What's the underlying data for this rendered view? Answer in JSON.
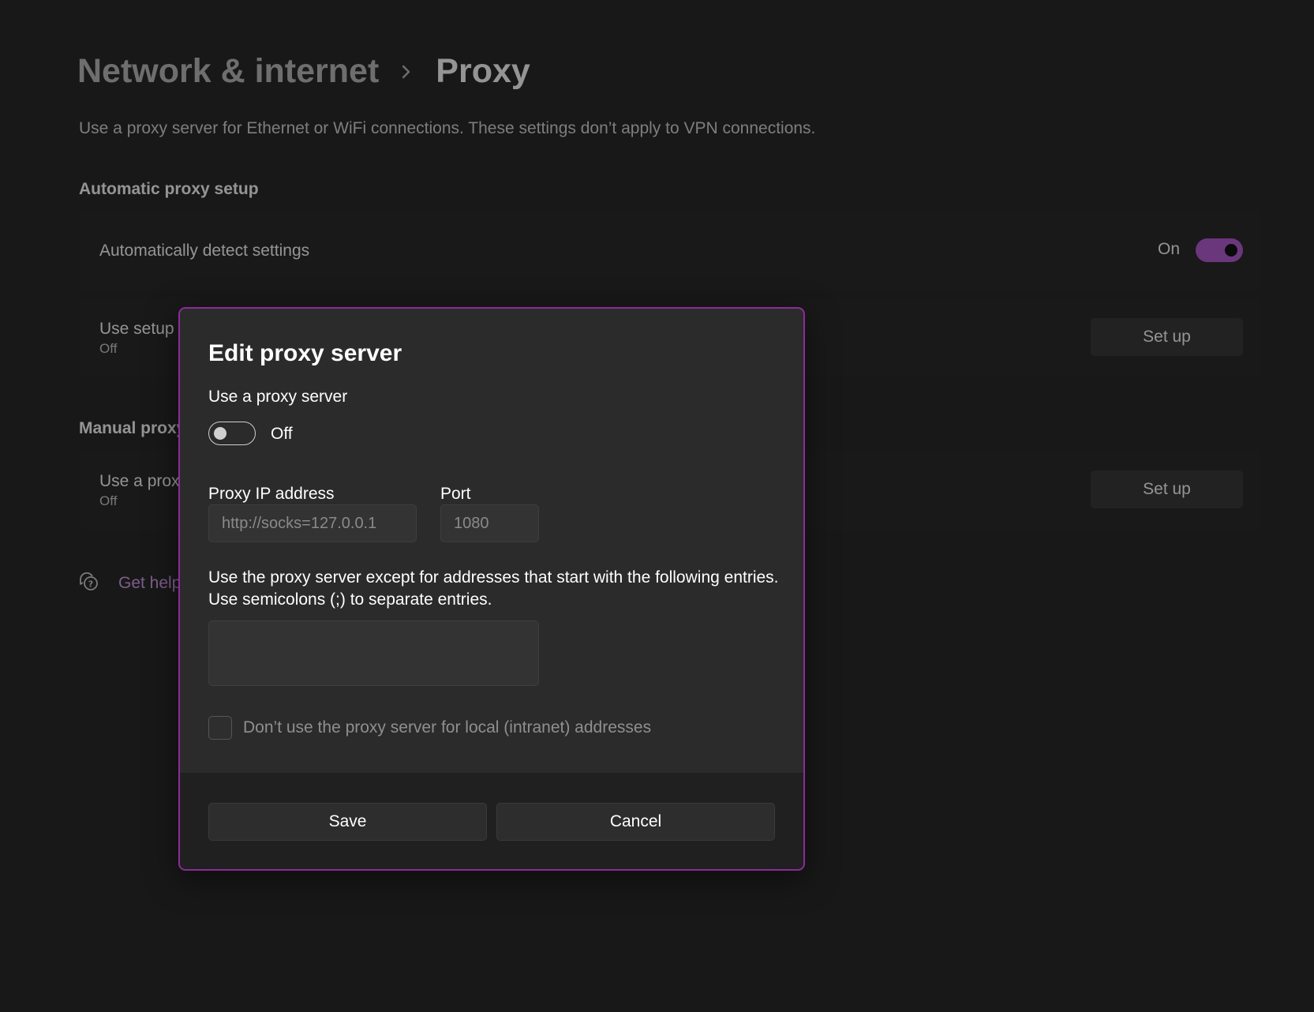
{
  "breadcrumb": {
    "parent": "Network & internet",
    "current": "Proxy"
  },
  "description": "Use a proxy server for Ethernet or WiFi connections. These settings don’t apply to VPN connections.",
  "automatic": {
    "section_title": "Automatic proxy setup",
    "detect": {
      "title": "Automatically detect settings",
      "state_label": "On",
      "enabled": true
    },
    "script": {
      "title": "Use setup s",
      "status": "Off",
      "button": "Set up"
    }
  },
  "manual": {
    "section_title": "Manual proxy",
    "use_proxy": {
      "title": "Use a proxy",
      "status": "Off",
      "button": "Set up"
    }
  },
  "help": {
    "label": "Get help"
  },
  "dialog": {
    "title": "Edit proxy server",
    "use_proxy_label": "Use a proxy server",
    "toggle_state": "Off",
    "ip_label": "Proxy IP address",
    "ip_placeholder": "http://socks=127.0.0.1",
    "port_label": "Port",
    "port_placeholder": "1080",
    "exceptions_line1": "Use the proxy server except for addresses that start with the following entries.",
    "exceptions_line2": "Use semicolons (;) to separate entries.",
    "exceptions_value": "",
    "local_checkbox_label": "Don’t use the proxy server for local (intranet) addresses",
    "local_checkbox_checked": false,
    "save": "Save",
    "cancel": "Cancel"
  },
  "colors": {
    "accent": "#b85fd6",
    "dialog_border": "#8e2a9c",
    "link": "#d7a1ef"
  }
}
